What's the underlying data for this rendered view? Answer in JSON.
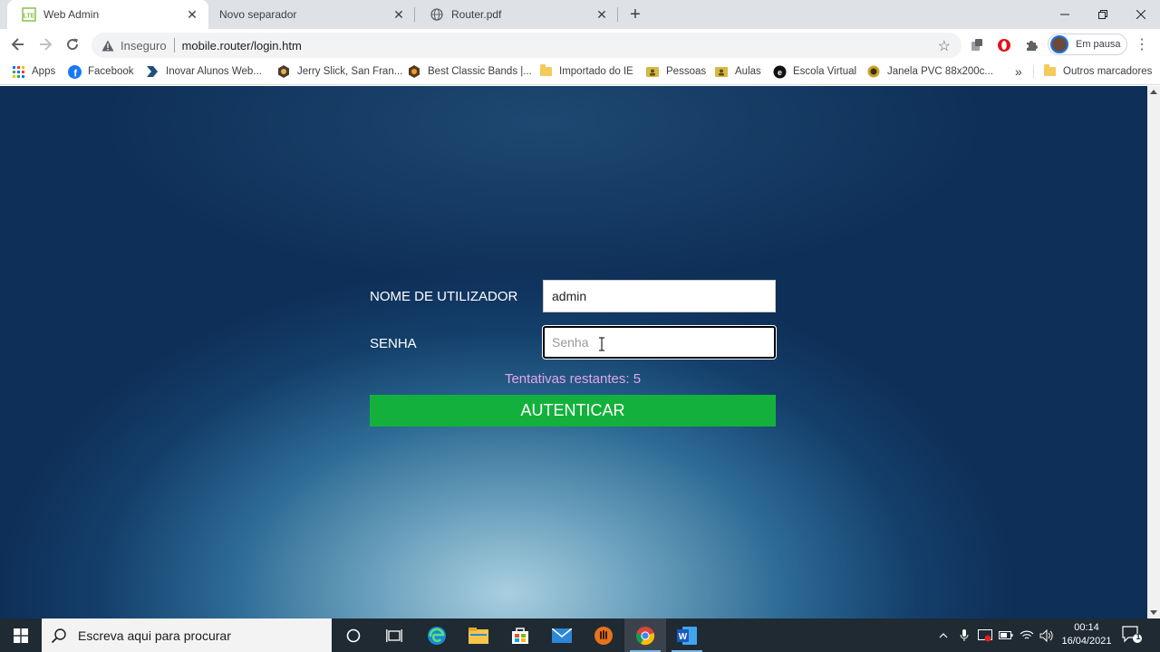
{
  "browser": {
    "tabs": [
      {
        "title": "Web Admin",
        "favicon": "lte-icon",
        "active": true
      },
      {
        "title": "Novo separador",
        "favicon": "none",
        "active": false
      },
      {
        "title": "Router.pdf",
        "favicon": "globe-icon",
        "active": false
      }
    ],
    "address": {
      "security_label": "Inseguro",
      "url": "mobile.router/login.htm"
    },
    "profile_label": "Em pausa",
    "bookmarks": [
      {
        "label": "Apps",
        "icon": "apps-grid-icon"
      },
      {
        "label": "Facebook",
        "icon": "facebook-icon"
      },
      {
        "label": "Inovar Alunos Web...",
        "icon": "inovar-icon"
      },
      {
        "label": "Jerry Slick, San Fran...",
        "icon": "site-icon"
      },
      {
        "label": "Best Classic Bands |...",
        "icon": "site-icon"
      },
      {
        "label": "Importado do IE",
        "icon": "folder-icon"
      },
      {
        "label": "Pessoas",
        "icon": "shared-folder-icon"
      },
      {
        "label": "Aulas",
        "icon": "shared-folder-icon"
      },
      {
        "label": "Escola Virtual",
        "icon": "site-icon"
      },
      {
        "label": "Janela PVC 88x200c...",
        "icon": "site-icon"
      }
    ],
    "bookmarks_overflow": "»",
    "other_bookmarks": "Outros marcadores"
  },
  "login": {
    "username_label": "NOME DE UTILIZADOR",
    "username_value": "admin",
    "password_label": "SENHA",
    "password_placeholder": "Senha",
    "attempts_text": "Tentativas restantes: 5",
    "submit_label": "AUTENTICAR"
  },
  "taskbar": {
    "search_placeholder": "Escreva aqui para procurar",
    "time": "00:14",
    "date": "16/04/2021",
    "notification_count": "1"
  },
  "colors": {
    "submit_button": "#13b13b",
    "attempts_text": "#e2a6e8",
    "page_background": "#143f6b"
  }
}
